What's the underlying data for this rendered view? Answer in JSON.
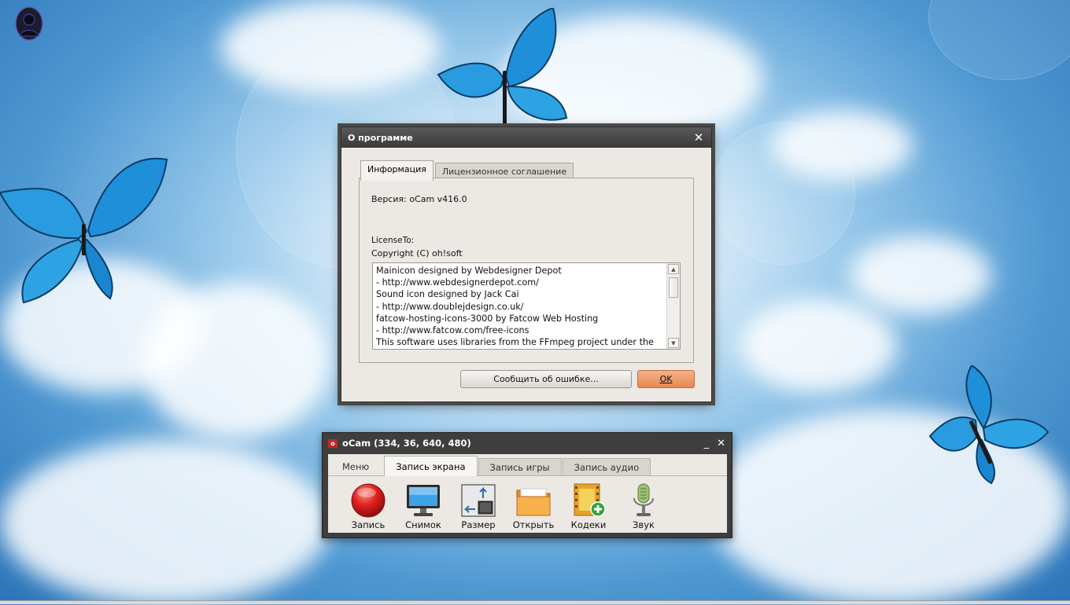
{
  "about_dialog": {
    "title": "О программе",
    "tabs": [
      "Информация",
      "Лицензионное соглашение"
    ],
    "version_line": "Версия: oCam v416.0",
    "license_to": "LicenseTo:",
    "copyright": "Copyright (C) oh!soft",
    "credits": [
      "Mainicon designed by Webdesigner Depot",
      "- http://www.webdesignerdepot.com/",
      "Sound icon designed by Jack Cai",
      "- http://www.doublejdesign.co.uk/",
      "fatcow-hosting-icons-3000 by Fatcow Web Hosting",
      "- http://www.fatcow.com/free-icons",
      "This software uses libraries from the FFmpeg project under the"
    ],
    "report_button": "Сообщить об ошибке...",
    "ok_button": "OK",
    "close_glyph": "✕"
  },
  "ocam": {
    "title": "oCam (334, 36, 640, 480)",
    "logo_text": "o",
    "minimize_glyph": "_",
    "close_glyph": "✕",
    "tabs": [
      "Меню",
      "Запись экрана",
      "Запись игры",
      "Запись аудио"
    ],
    "active_tab": "Запись экрана",
    "tools": [
      {
        "label": "Запись",
        "icon": "record-icon"
      },
      {
        "label": "Снимок",
        "icon": "monitor-screenshot-icon"
      },
      {
        "label": "Размер",
        "icon": "resize-icon"
      },
      {
        "label": "Открыть",
        "icon": "folder-icon"
      },
      {
        "label": "Кодеки",
        "icon": "codec-film-icon"
      },
      {
        "label": "Звук",
        "icon": "microphone-icon"
      }
    ]
  },
  "desktop": {
    "icons": [
      "user-avatar-icon"
    ],
    "wallpaper": "blue sky with butterflies"
  },
  "colors": {
    "accent_ok": "#e98650",
    "titlebar": "#3a3a3a",
    "record_red": "#d42020"
  }
}
